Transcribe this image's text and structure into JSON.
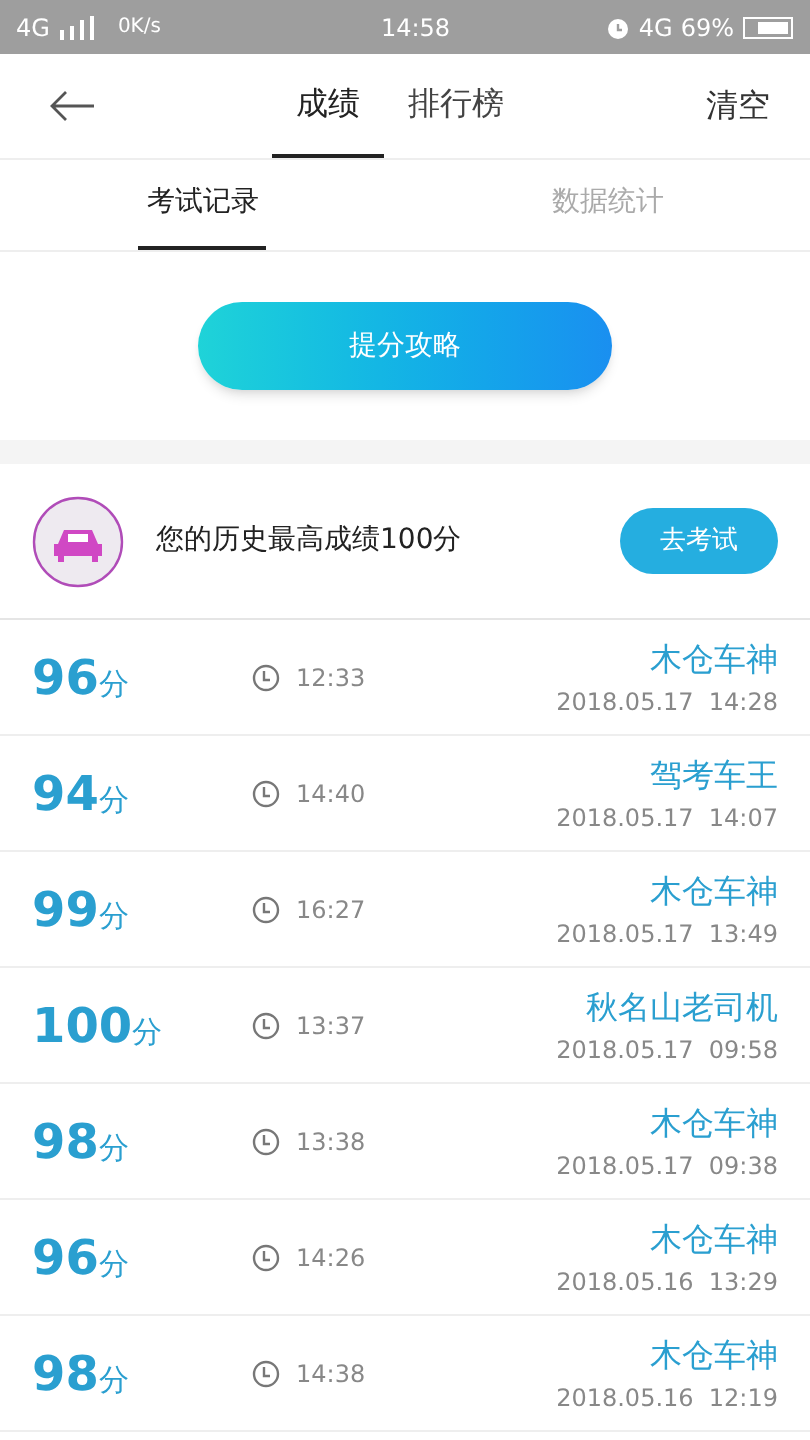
{
  "status_bar": {
    "network": "4G",
    "speed": "0K/s",
    "time": "14:58",
    "network_right": "4G",
    "battery": "69%"
  },
  "nav": {
    "tabs": [
      {
        "label": "成绩",
        "selected": true
      },
      {
        "label": "排行榜",
        "selected": false
      }
    ],
    "action": "清空"
  },
  "sub_tabs": [
    {
      "label": "考试记录",
      "selected": true
    },
    {
      "label": "数据统计",
      "selected": false
    }
  ],
  "tips_button": "提分攻略",
  "best": {
    "text": "您的历史最高成绩100分",
    "button": "去考试"
  },
  "records": [
    {
      "score": "96",
      "unit": "分",
      "duration": "12:33",
      "title": "木仓车神",
      "date": "2018.05.17  14:28"
    },
    {
      "score": "94",
      "unit": "分",
      "duration": "14:40",
      "title": "驾考车王",
      "date": "2018.05.17  14:07"
    },
    {
      "score": "99",
      "unit": "分",
      "duration": "16:27",
      "title": "木仓车神",
      "date": "2018.05.17  13:49"
    },
    {
      "score": "100",
      "unit": "分",
      "duration": "13:37",
      "title": "秋名山老司机",
      "date": "2018.05.17  09:58"
    },
    {
      "score": "98",
      "unit": "分",
      "duration": "13:38",
      "title": "木仓车神",
      "date": "2018.05.17  09:38"
    },
    {
      "score": "96",
      "unit": "分",
      "duration": "14:26",
      "title": "木仓车神",
      "date": "2018.05.16  13:29"
    },
    {
      "score": "98",
      "unit": "分",
      "duration": "14:38",
      "title": "木仓车神",
      "date": "2018.05.16  12:19"
    }
  ]
}
